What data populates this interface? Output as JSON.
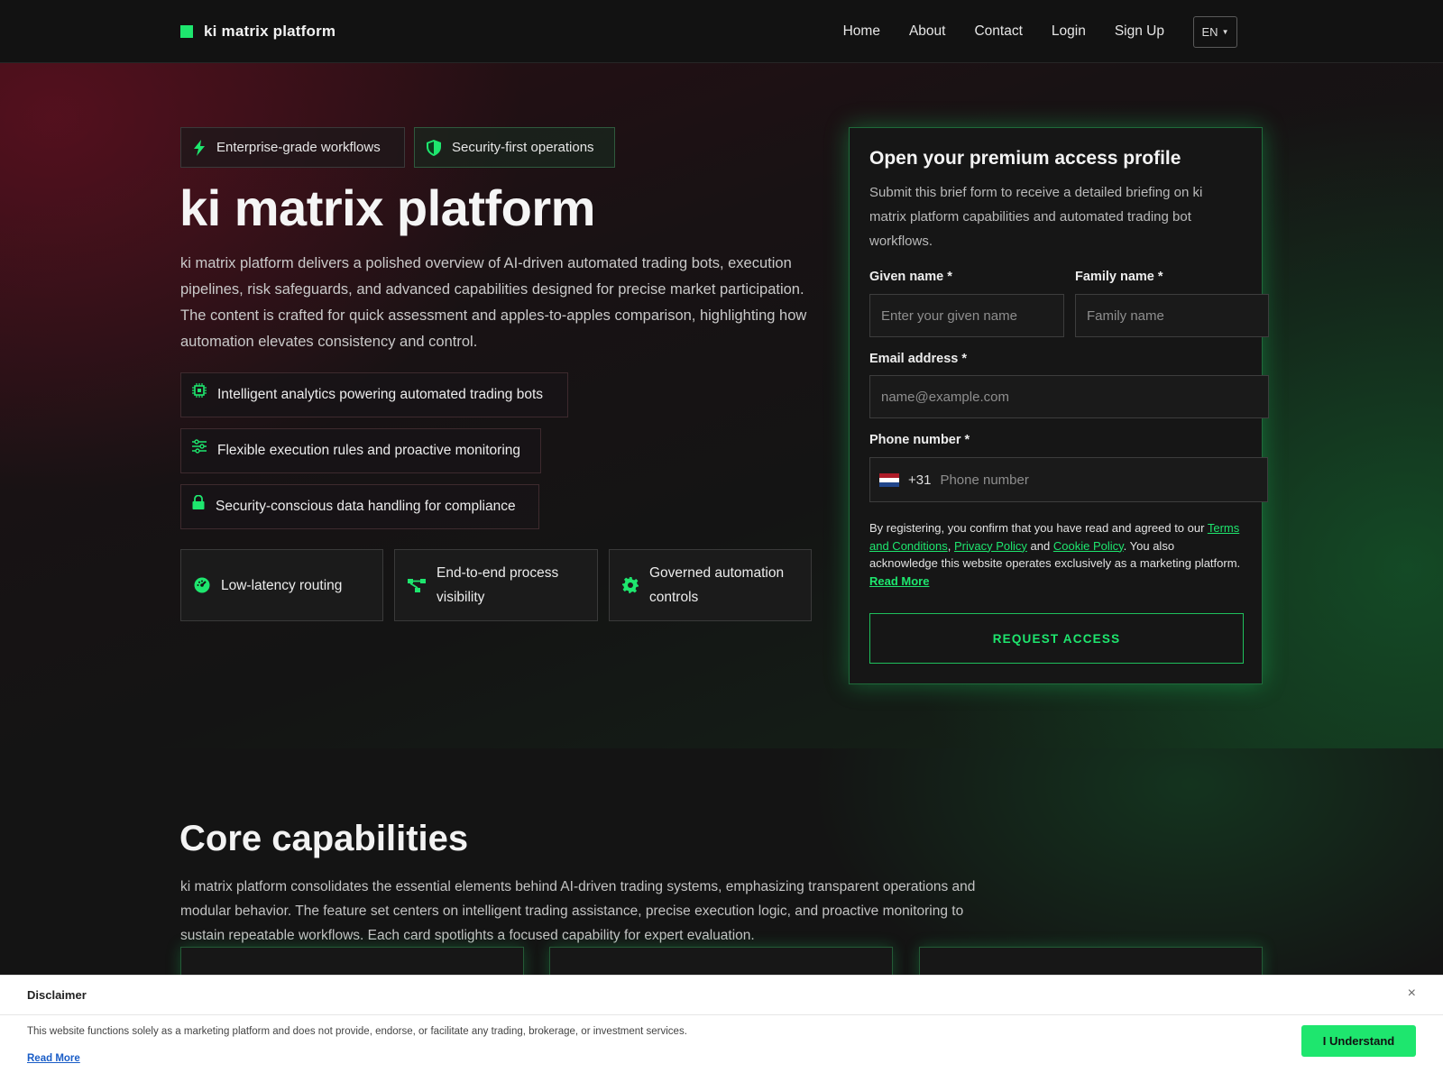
{
  "brand": {
    "name": "ki matrix platform",
    "accent": "#1ee66e"
  },
  "nav": {
    "items": [
      "Home",
      "About",
      "Contact",
      "Login",
      "Sign Up"
    ],
    "lang": "EN"
  },
  "hero": {
    "badges": [
      "Enterprise-grade workflows",
      "Security-first operations"
    ],
    "title": "ki matrix platform",
    "description": "ki matrix platform delivers a polished overview of AI-driven automated trading bots, execution pipelines, risk safeguards, and advanced capabilities designed for precise market participation. The content is crafted for quick assessment and apples-to-apples comparison, highlighting how automation elevates consistency and control.",
    "features": [
      {
        "icon": "chip-icon",
        "label": "Intelligent analytics powering automated trading bots"
      },
      {
        "icon": "sliders-icon",
        "label": "Flexible execution rules and proactive monitoring"
      },
      {
        "icon": "lock-icon",
        "label": "Security-conscious data handling for compliance"
      }
    ],
    "capabilities": [
      {
        "icon": "gauge-icon",
        "label": "Low-latency routing"
      },
      {
        "icon": "network-icon",
        "label": "End-to-end process visibility"
      },
      {
        "icon": "gear-icon",
        "label": "Governed automation controls"
      }
    ]
  },
  "form": {
    "title": "Open your premium access profile",
    "description": "Submit this brief form to receive a detailed briefing on ki matrix platform capabilities and automated trading bot workflows.",
    "given_label": "Given name *",
    "given_placeholder": "Enter your given name",
    "family_label": "Family name *",
    "family_placeholder": "Family name",
    "email_label": "Email address *",
    "email_placeholder": "name@example.com",
    "phone_label": "Phone number *",
    "dial_code": "+31",
    "phone_placeholder": "Phone number",
    "consent": {
      "prefix": "By registering, you confirm that you have read and agreed to our",
      "terms": "Terms and Conditions",
      "comma": ",",
      "privacy": "Privacy Policy",
      "and": "and",
      "cookie": "Cookie Policy",
      "suffix": ". You also acknowledge this website operates exclusively as a marketing platform.",
      "read_more": "Read More"
    },
    "submit": "REQUEST ACCESS"
  },
  "core": {
    "title": "Core capabilities",
    "description": "ki matrix platform consolidates the essential elements behind AI-driven trading systems, emphasizing transparent operations and modular behavior. The feature set centers on intelligent trading assistance, precise execution logic, and proactive monitoring to sustain repeatable workflows. Each card spotlights a focused capability for expert evaluation."
  },
  "disclaimer": {
    "title": "Disclaimer",
    "close": "×",
    "text": "This website functions solely as a marketing platform and does not provide, endorse, or facilitate any trading, brokerage, or investment services.",
    "read_more": "Read More",
    "button": "I Understand"
  }
}
